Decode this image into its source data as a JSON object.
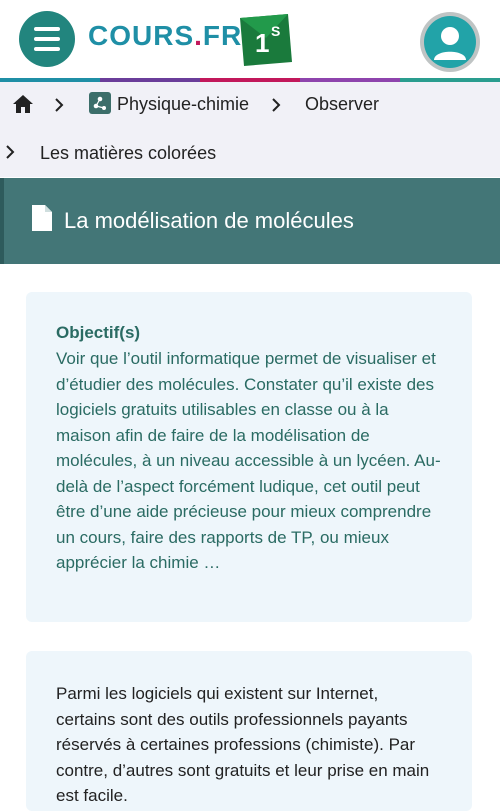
{
  "header": {
    "logo_main": "COURS",
    "logo_dot": ".",
    "logo_tld": "FR",
    "level": "1",
    "level_sup": "S"
  },
  "rainbow_colors": [
    "#1f8fa6",
    "#6a3d9a",
    "#c2185b",
    "#8e44ad",
    "#2a9d8f"
  ],
  "breadcrumb": {
    "subject": "Physique-chimie",
    "section": "Observer",
    "chapter": "Les matières colorées"
  },
  "page": {
    "title": "La modélisation de molécules"
  },
  "card1": {
    "heading": "Objectif(s)",
    "text": "Voir que l’outil informatique permet de visualiser et d’étudier des molécules. Constater qu’il existe des logiciels gratuits utilisables en classe ou à la maison afin de faire de la modélisation de molécules, à un niveau accessible à un lycéen. Au-delà de l’aspect forcément ludique, cet outil peut être d’une aide précieuse pour mieux comprendre un cours, faire des rapports de TP, ou mieux apprécier la chimie …"
  },
  "card2": {
    "text": "Parmi les logiciels qui existent sur Internet, certains sont des outils professionnels payants réservés à certaines professions (chimiste). Par contre, d’autres sont gratuits et leur prise en main est facile."
  },
  "colors": {
    "brand": "#22857e",
    "title_bar": "#437677",
    "objective_text": "#2a6b63",
    "card_bg": "#eef6fb"
  }
}
